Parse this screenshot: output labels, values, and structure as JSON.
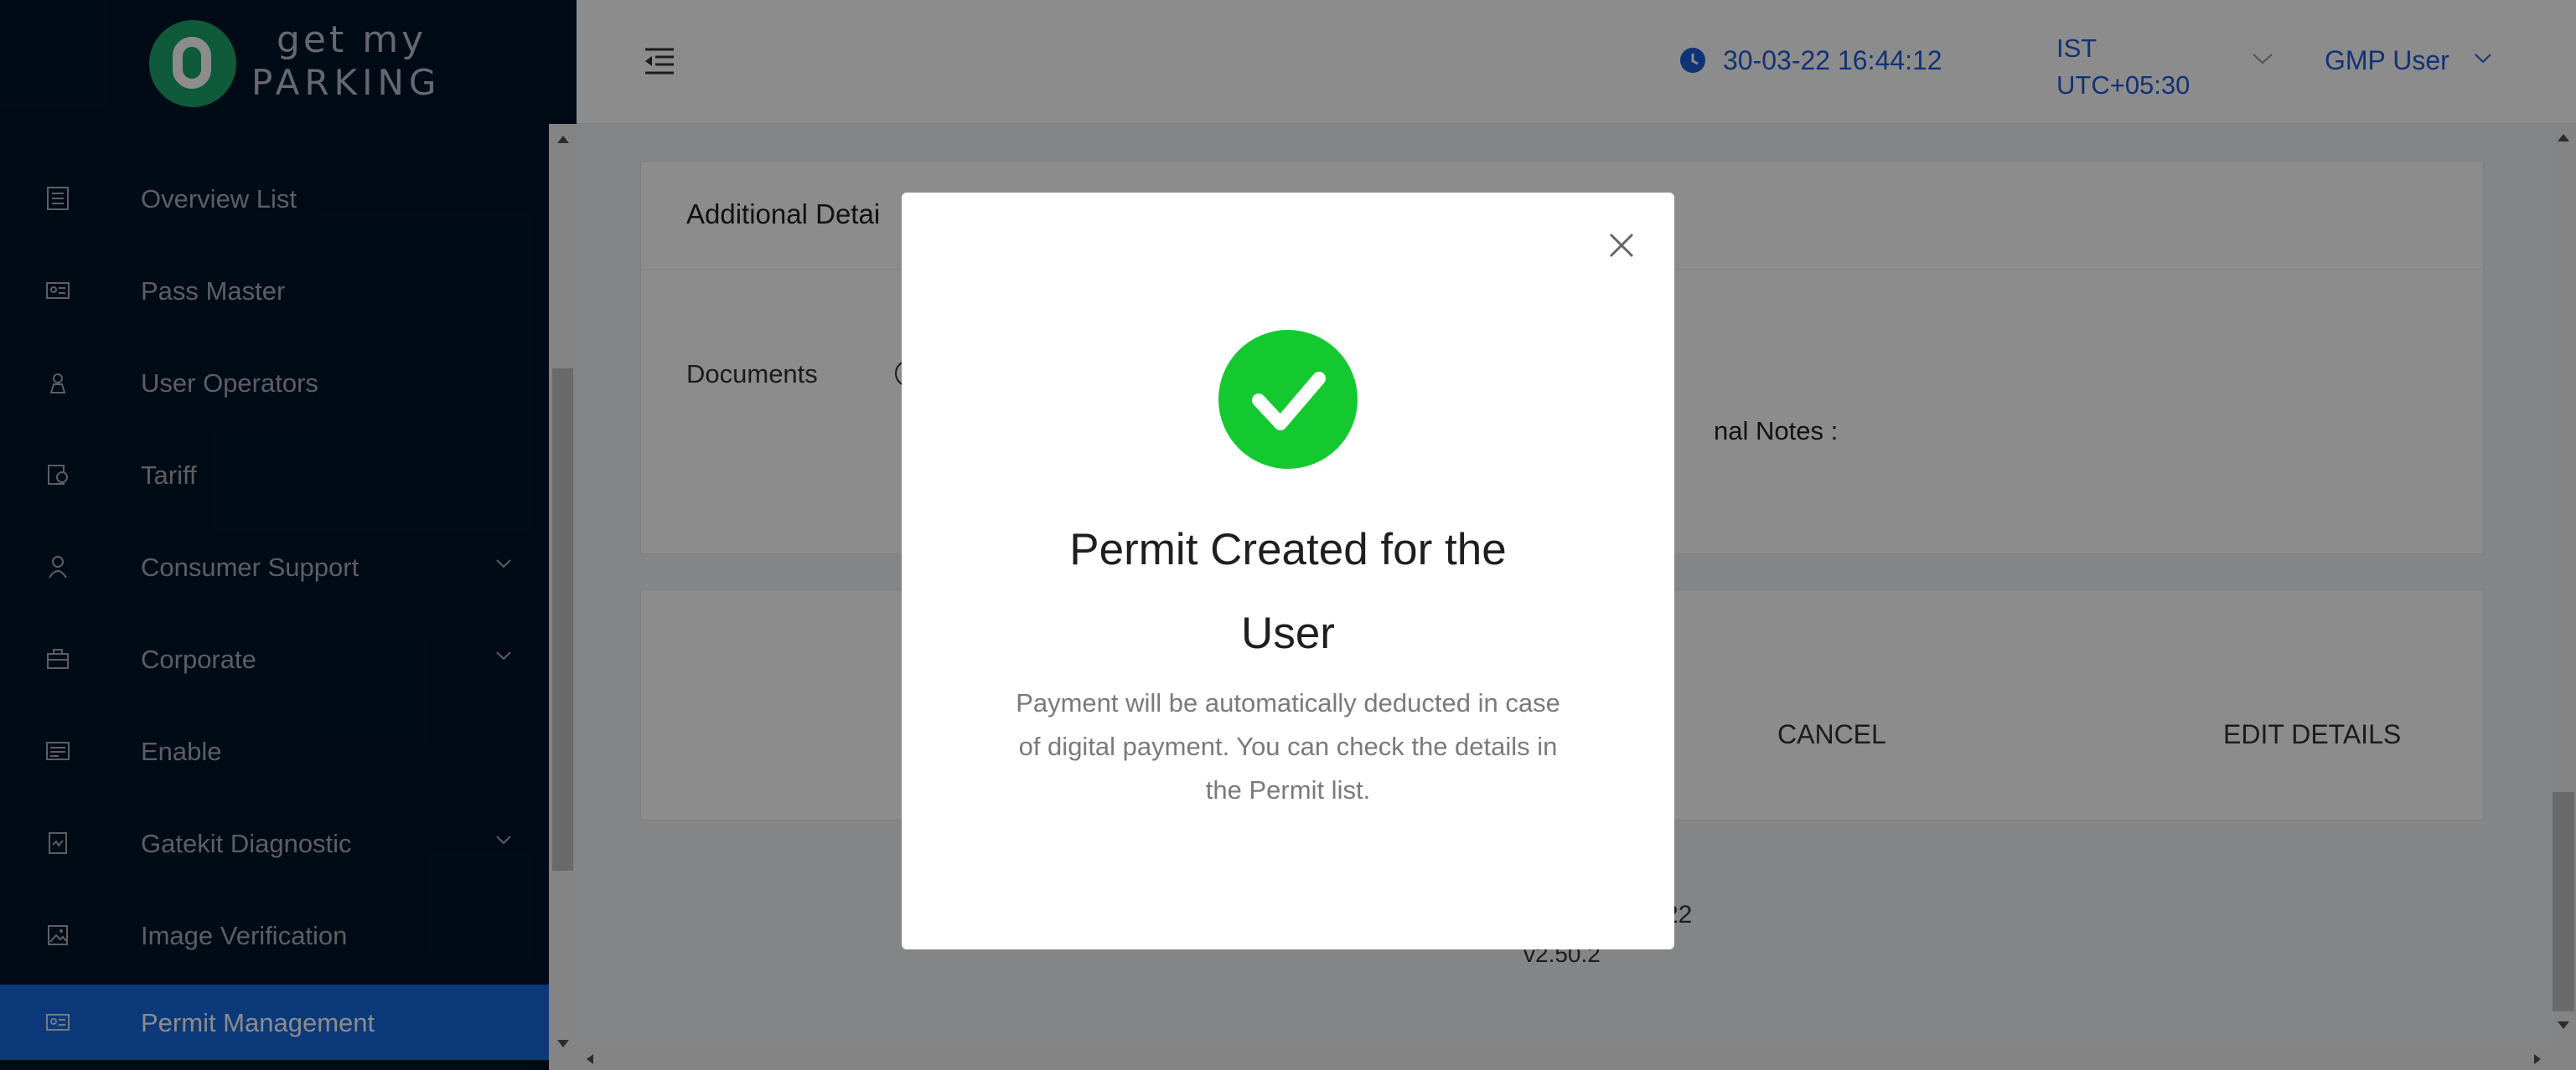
{
  "app": {
    "brand_top": "get my",
    "brand_bottom": "PARKING",
    "brand_color": "#1ba56b"
  },
  "sidebar": {
    "items": [
      {
        "label": "Overview List",
        "icon": "list-icon"
      },
      {
        "label": "Pass Master",
        "icon": "id-card-icon"
      },
      {
        "label": "User Operators",
        "icon": "operator-icon"
      },
      {
        "label": "Tariff",
        "icon": "tariff-icon"
      },
      {
        "label": "Consumer Support",
        "icon": "user-icon",
        "expandable": true
      },
      {
        "label": "Corporate",
        "icon": "briefcase-icon",
        "expandable": true
      },
      {
        "label": "Enable",
        "icon": "toggle-panel-icon"
      },
      {
        "label": "Gatekit Diagnostic",
        "icon": "diagnostic-icon",
        "expandable": true
      },
      {
        "label": "Image Verification",
        "icon": "image-icon"
      },
      {
        "label": "Permit Management",
        "icon": "permit-card-icon",
        "active": true
      }
    ],
    "active_color": "#1668dc"
  },
  "header": {
    "datetime": "30-03-22 16:44:12",
    "timezone_line1": "IST",
    "timezone_line2": "UTC+05:30",
    "user": "GMP User"
  },
  "content": {
    "section_title": "Additional Detai",
    "documents_label": "Documents",
    "notes_label": "nal Notes :",
    "cancel_label": "CANCEL",
    "edit_label": "EDIT DETAILS",
    "footer_year": "22",
    "footer_version": "v2.50.2"
  },
  "modal": {
    "title_line1": "Permit Created for the",
    "title_line2": "User",
    "description": "Payment will be automatically deducted in case of digital payment. You can check the details in the Permit list.",
    "success_color": "#13c92f"
  }
}
